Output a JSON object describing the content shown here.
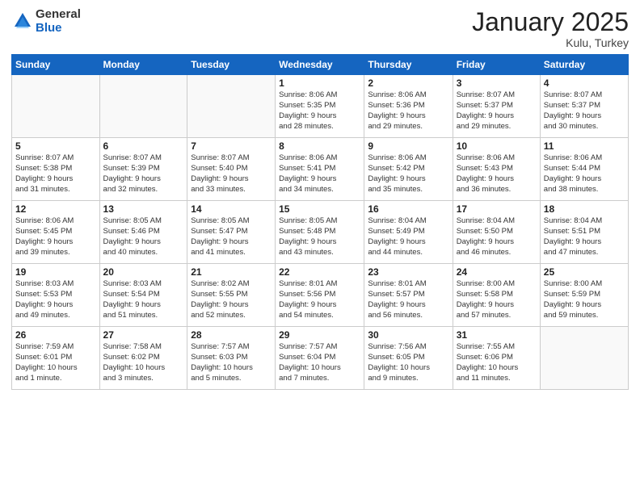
{
  "header": {
    "logo_general": "General",
    "logo_blue": "Blue",
    "month_title": "January 2025",
    "location": "Kulu, Turkey"
  },
  "weekdays": [
    "Sunday",
    "Monday",
    "Tuesday",
    "Wednesday",
    "Thursday",
    "Friday",
    "Saturday"
  ],
  "weeks": [
    [
      {
        "day": "",
        "info": ""
      },
      {
        "day": "",
        "info": ""
      },
      {
        "day": "",
        "info": ""
      },
      {
        "day": "1",
        "info": "Sunrise: 8:06 AM\nSunset: 5:35 PM\nDaylight: 9 hours\nand 28 minutes."
      },
      {
        "day": "2",
        "info": "Sunrise: 8:06 AM\nSunset: 5:36 PM\nDaylight: 9 hours\nand 29 minutes."
      },
      {
        "day": "3",
        "info": "Sunrise: 8:07 AM\nSunset: 5:37 PM\nDaylight: 9 hours\nand 29 minutes."
      },
      {
        "day": "4",
        "info": "Sunrise: 8:07 AM\nSunset: 5:37 PM\nDaylight: 9 hours\nand 30 minutes."
      }
    ],
    [
      {
        "day": "5",
        "info": "Sunrise: 8:07 AM\nSunset: 5:38 PM\nDaylight: 9 hours\nand 31 minutes."
      },
      {
        "day": "6",
        "info": "Sunrise: 8:07 AM\nSunset: 5:39 PM\nDaylight: 9 hours\nand 32 minutes."
      },
      {
        "day": "7",
        "info": "Sunrise: 8:07 AM\nSunset: 5:40 PM\nDaylight: 9 hours\nand 33 minutes."
      },
      {
        "day": "8",
        "info": "Sunrise: 8:06 AM\nSunset: 5:41 PM\nDaylight: 9 hours\nand 34 minutes."
      },
      {
        "day": "9",
        "info": "Sunrise: 8:06 AM\nSunset: 5:42 PM\nDaylight: 9 hours\nand 35 minutes."
      },
      {
        "day": "10",
        "info": "Sunrise: 8:06 AM\nSunset: 5:43 PM\nDaylight: 9 hours\nand 36 minutes."
      },
      {
        "day": "11",
        "info": "Sunrise: 8:06 AM\nSunset: 5:44 PM\nDaylight: 9 hours\nand 38 minutes."
      }
    ],
    [
      {
        "day": "12",
        "info": "Sunrise: 8:06 AM\nSunset: 5:45 PM\nDaylight: 9 hours\nand 39 minutes."
      },
      {
        "day": "13",
        "info": "Sunrise: 8:05 AM\nSunset: 5:46 PM\nDaylight: 9 hours\nand 40 minutes."
      },
      {
        "day": "14",
        "info": "Sunrise: 8:05 AM\nSunset: 5:47 PM\nDaylight: 9 hours\nand 41 minutes."
      },
      {
        "day": "15",
        "info": "Sunrise: 8:05 AM\nSunset: 5:48 PM\nDaylight: 9 hours\nand 43 minutes."
      },
      {
        "day": "16",
        "info": "Sunrise: 8:04 AM\nSunset: 5:49 PM\nDaylight: 9 hours\nand 44 minutes."
      },
      {
        "day": "17",
        "info": "Sunrise: 8:04 AM\nSunset: 5:50 PM\nDaylight: 9 hours\nand 46 minutes."
      },
      {
        "day": "18",
        "info": "Sunrise: 8:04 AM\nSunset: 5:51 PM\nDaylight: 9 hours\nand 47 minutes."
      }
    ],
    [
      {
        "day": "19",
        "info": "Sunrise: 8:03 AM\nSunset: 5:53 PM\nDaylight: 9 hours\nand 49 minutes."
      },
      {
        "day": "20",
        "info": "Sunrise: 8:03 AM\nSunset: 5:54 PM\nDaylight: 9 hours\nand 51 minutes."
      },
      {
        "day": "21",
        "info": "Sunrise: 8:02 AM\nSunset: 5:55 PM\nDaylight: 9 hours\nand 52 minutes."
      },
      {
        "day": "22",
        "info": "Sunrise: 8:01 AM\nSunset: 5:56 PM\nDaylight: 9 hours\nand 54 minutes."
      },
      {
        "day": "23",
        "info": "Sunrise: 8:01 AM\nSunset: 5:57 PM\nDaylight: 9 hours\nand 56 minutes."
      },
      {
        "day": "24",
        "info": "Sunrise: 8:00 AM\nSunset: 5:58 PM\nDaylight: 9 hours\nand 57 minutes."
      },
      {
        "day": "25",
        "info": "Sunrise: 8:00 AM\nSunset: 5:59 PM\nDaylight: 9 hours\nand 59 minutes."
      }
    ],
    [
      {
        "day": "26",
        "info": "Sunrise: 7:59 AM\nSunset: 6:01 PM\nDaylight: 10 hours\nand 1 minute."
      },
      {
        "day": "27",
        "info": "Sunrise: 7:58 AM\nSunset: 6:02 PM\nDaylight: 10 hours\nand 3 minutes."
      },
      {
        "day": "28",
        "info": "Sunrise: 7:57 AM\nSunset: 6:03 PM\nDaylight: 10 hours\nand 5 minutes."
      },
      {
        "day": "29",
        "info": "Sunrise: 7:57 AM\nSunset: 6:04 PM\nDaylight: 10 hours\nand 7 minutes."
      },
      {
        "day": "30",
        "info": "Sunrise: 7:56 AM\nSunset: 6:05 PM\nDaylight: 10 hours\nand 9 minutes."
      },
      {
        "day": "31",
        "info": "Sunrise: 7:55 AM\nSunset: 6:06 PM\nDaylight: 10 hours\nand 11 minutes."
      },
      {
        "day": "",
        "info": ""
      }
    ]
  ]
}
